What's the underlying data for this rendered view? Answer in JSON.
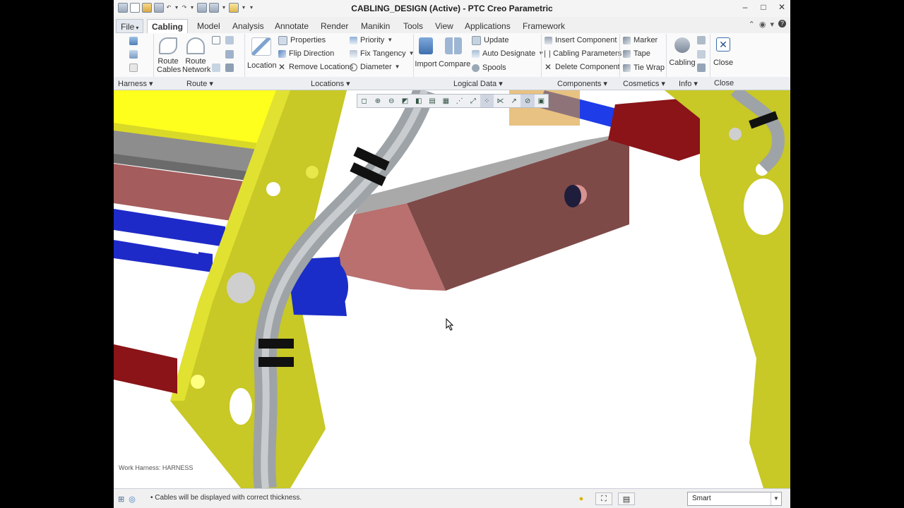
{
  "window": {
    "title": "CABLING_DESIGN (Active) - PTC Creo Parametric",
    "controls": {
      "minimize": "–",
      "maximize": "□",
      "close": "✕"
    }
  },
  "menu": {
    "tabs": [
      "File",
      "Cabling",
      "Model",
      "Analysis",
      "Annotate",
      "Render",
      "Manikin",
      "Tools",
      "View",
      "Applications",
      "Framework"
    ],
    "file_caret": "▾",
    "active": "Cabling"
  },
  "ribbon": {
    "harness": {
      "icons": [
        "harness-icon",
        "insert-harness-icon",
        "harness-table-icon"
      ]
    },
    "route": {
      "route_cables": [
        "Route",
        "Cables"
      ],
      "route_network": [
        "Route",
        "Network"
      ],
      "small_icons": [
        "route-path-icon",
        "bracket-icon",
        "network-branch-icon",
        "split-icon",
        "merge-icon",
        "flat-route-icon"
      ]
    },
    "locations": {
      "location": "Location",
      "properties": "Properties",
      "flip_direction": "Flip Direction",
      "remove_locations": "Remove Locations",
      "priority": "Priority",
      "fix_tangency": "Fix Tangency",
      "diameter": "Diameter"
    },
    "logical_data": {
      "import": "Import",
      "compare": "Compare",
      "update": "Update",
      "auto_designate": "Auto Designate",
      "spools": "Spools"
    },
    "components": {
      "insert_component": "Insert Component",
      "cabling_parameters": "Cabling Parameters",
      "delete_component": "Delete Component"
    },
    "cosmetics": {
      "marker": "Marker",
      "tape": "Tape",
      "tie_wrap": "Tie Wrap"
    },
    "info": {
      "cabling": "Cabling"
    },
    "close": {
      "close": "Close"
    }
  },
  "groups": [
    "Harness ▾",
    "Route ▾",
    "Locations ▾",
    "Logical Data ▾",
    "Components ▾",
    "Cosmetics ▾",
    "Info ▾",
    "Close"
  ],
  "viewport": {
    "work_harness": "Work Harness: HARNESS",
    "toolbar_icons": [
      "refit-icon",
      "zoom-in-icon",
      "zoom-out-icon",
      "repaint-icon",
      "display-style-icon",
      "saved-views-icon",
      "view-manager-icon",
      "datum-planes-icon",
      "datum-axes-icon",
      "datum-points-icon",
      "csys-icon",
      "spin-center-icon",
      "annotation-icon",
      "cable-display-icon"
    ]
  },
  "status": {
    "message": "• Cables will be displayed with correct thickness.",
    "filter": "Smart",
    "colors": {
      "frame": "#c8c82a",
      "cable": "#9ea3a7",
      "blue": "#1a2dc8",
      "red": "#8a1418",
      "block": "#8a5a58"
    }
  }
}
